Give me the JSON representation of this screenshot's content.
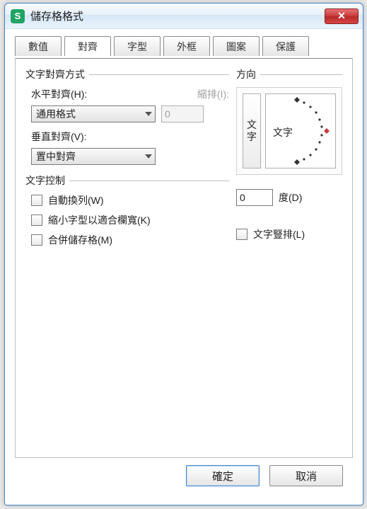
{
  "window": {
    "title": "儲存格格式"
  },
  "tabs": [
    "數值",
    "對齊",
    "字型",
    "外框",
    "圖案",
    "保護"
  ],
  "active_tab_index": 1,
  "align": {
    "group_label": "文字對齊方式",
    "horizontal_label": "水平對齊(H):",
    "horizontal_value": "通用格式",
    "indent_label": "縮排(I):",
    "indent_value": "0",
    "vertical_label": "垂直對齊(V):",
    "vertical_value": "置中對齊"
  },
  "textctrl": {
    "group_label": "文字控制",
    "wrap": "自動換列(W)",
    "shrink": "縮小字型以適合欄寬(K)",
    "merge": "合併儲存格(M)"
  },
  "orientation": {
    "group_label": "方向",
    "vertical_button": "文字",
    "dial_label": "文字",
    "degree_value": "0",
    "degree_label": "度(D)",
    "stacked_label": "文字豎排(L)"
  },
  "buttons": {
    "ok": "確定",
    "cancel": "取消"
  },
  "icons": {
    "app": "S",
    "close": "✕"
  }
}
